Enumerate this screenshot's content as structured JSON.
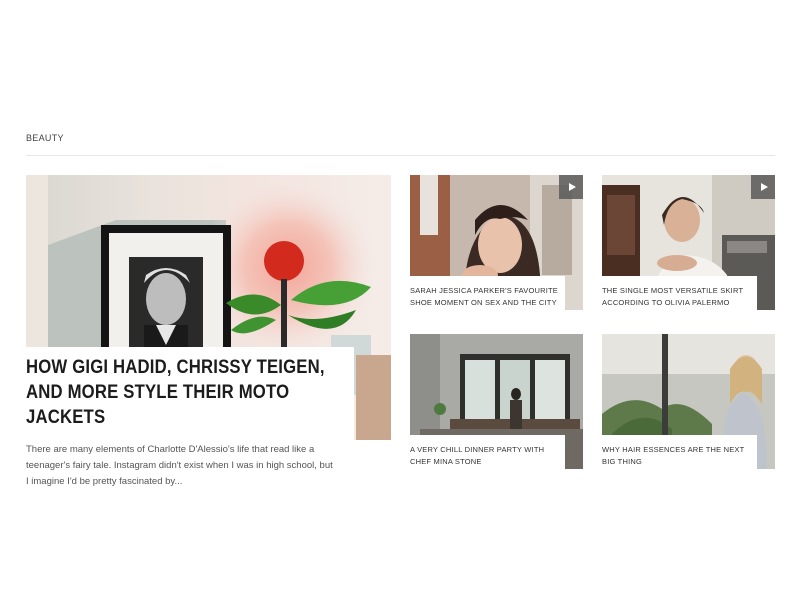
{
  "section": {
    "label": "BEAUTY"
  },
  "feature": {
    "title": "HOW GIGI HADID, CHRISSY TEIGEN, AND MORE STYLE THEIR MOTO JACKETS",
    "excerpt": "There are many elements of Charlotte D'Alessio's life that read like a teenager's fairy tale. Instagram didn't exist when I was in high school, but I imagine I'd be pretty fascinated by..."
  },
  "cards": [
    {
      "title": "SARAH JESSICA PARKER'S FAVOURITE SHOE MOMENT ON SEX AND THE CITY",
      "video": true
    },
    {
      "title": "THE SINGLE MOST VERSATILE SKIRT ACCORDING TO OLIVIA PALERMO",
      "video": true
    },
    {
      "title": "A VERY CHILL DINNER PARTY WITH CHEF MINA STONE",
      "video": false
    },
    {
      "title": "WHY HAIR ESSENCES ARE THE NEXT BIG THING",
      "video": false
    }
  ],
  "icons": {
    "video_badge": "play-icon"
  }
}
